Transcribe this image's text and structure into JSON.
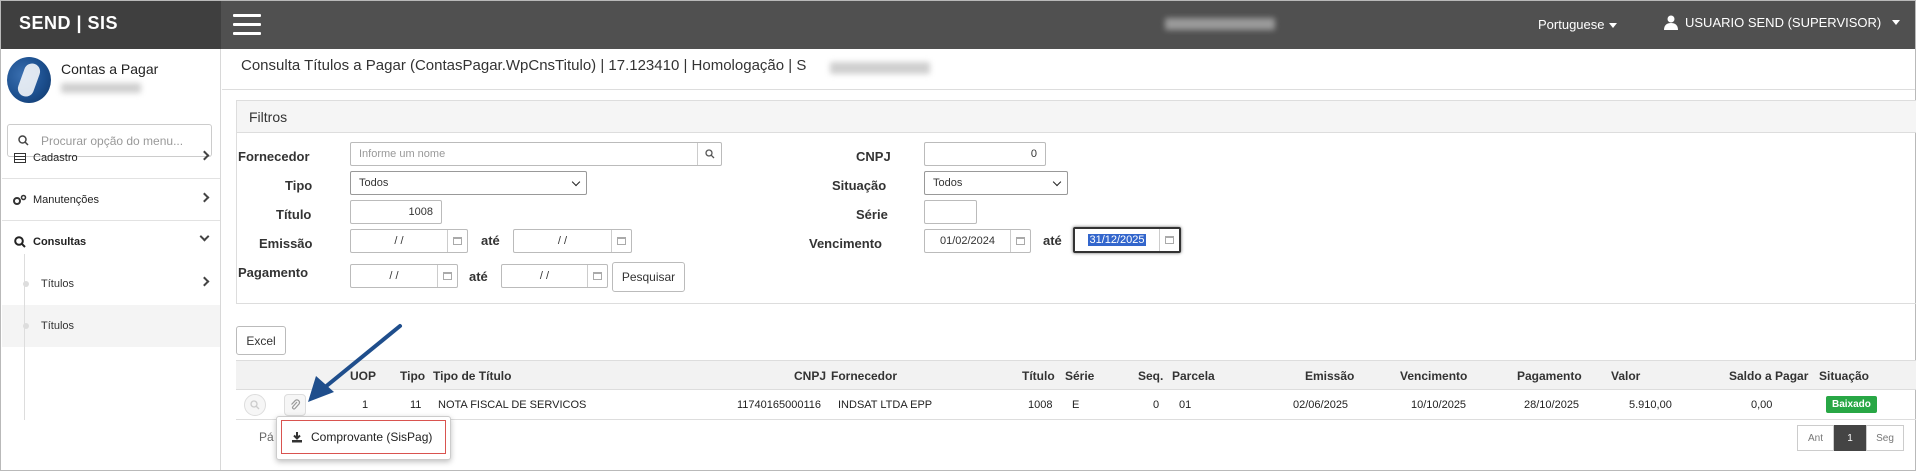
{
  "brand": "SEND | SIS",
  "topbar": {
    "language": "Portuguese",
    "user": "USUARIO SEND (SUPERVISOR)"
  },
  "sidebar": {
    "module_title": "Contas a Pagar",
    "search_placeholder": "Procurar opção do menu...",
    "items": [
      {
        "label": "Cadastro"
      },
      {
        "label": "Manutenções"
      },
      {
        "label": "Consultas"
      }
    ],
    "subitems": [
      {
        "label": "Títulos"
      },
      {
        "label": "Títulos"
      }
    ]
  },
  "page_title": "Consulta Títulos a Pagar (ContasPagar.WpCnsTitulo) | 17.123410 | Homologação | S",
  "filters": {
    "title": "Filtros",
    "fornecedor_label": "Fornecedor",
    "fornecedor_placeholder": "Informe um nome",
    "tipo_label": "Tipo",
    "tipo_value": "Todos",
    "titulo_label": "Título",
    "titulo_value": "1008",
    "emissao_label": "Emissão",
    "emissao_from": "/ /",
    "emissao_to": "/ /",
    "pagamento_label": "Pagamento",
    "pagamento_from": "/ /",
    "pagamento_to": "/ /",
    "ate_label": "até",
    "pesquisar": "Pesquisar",
    "cnpj_label": "CNPJ",
    "cnpj_value": "0",
    "situacao_label": "Situação",
    "situacao_value": "Todos",
    "serie_label": "Série",
    "serie_value": "",
    "vencimento_label": "Vencimento",
    "vencimento_from": "01/02/2024",
    "vencimento_to": "31/12/2025"
  },
  "excel_button": "Excel",
  "table": {
    "headers": [
      "UOP",
      "Tipo",
      "Tipo de Título",
      "CNPJ",
      "Fornecedor",
      "Título",
      "Série",
      "Seq.",
      "Parcela",
      "Emissão",
      "Vencimento",
      "Pagamento",
      "Valor",
      "Saldo a Pagar",
      "Situação"
    ],
    "row": {
      "uop": "1",
      "tipo": "11",
      "tipo_titulo": "NOTA FISCAL DE SERVICOS",
      "cnpj": "11740165000116",
      "fornecedor": "INDSAT LTDA EPP",
      "titulo": "1008",
      "serie": "E",
      "seq": "0",
      "parcela": "01",
      "emissao": "02/06/2025",
      "vencimento": "10/10/2025",
      "pagamento": "28/10/2025",
      "valor": "5.910,00",
      "saldo": "0,00",
      "situacao": "Baixado"
    }
  },
  "pagination": {
    "label_partial": "Pá",
    "prev": "Ant",
    "current": "1",
    "next": "Seg"
  },
  "dropdown_item": "Comprovante (SisPag)",
  "colors": {
    "topbar": "#505050",
    "brand_bg": "#3f3f3f",
    "badge": "#28a745",
    "arrow": "#1f4e8c",
    "highlight_border": "#d9534f"
  }
}
